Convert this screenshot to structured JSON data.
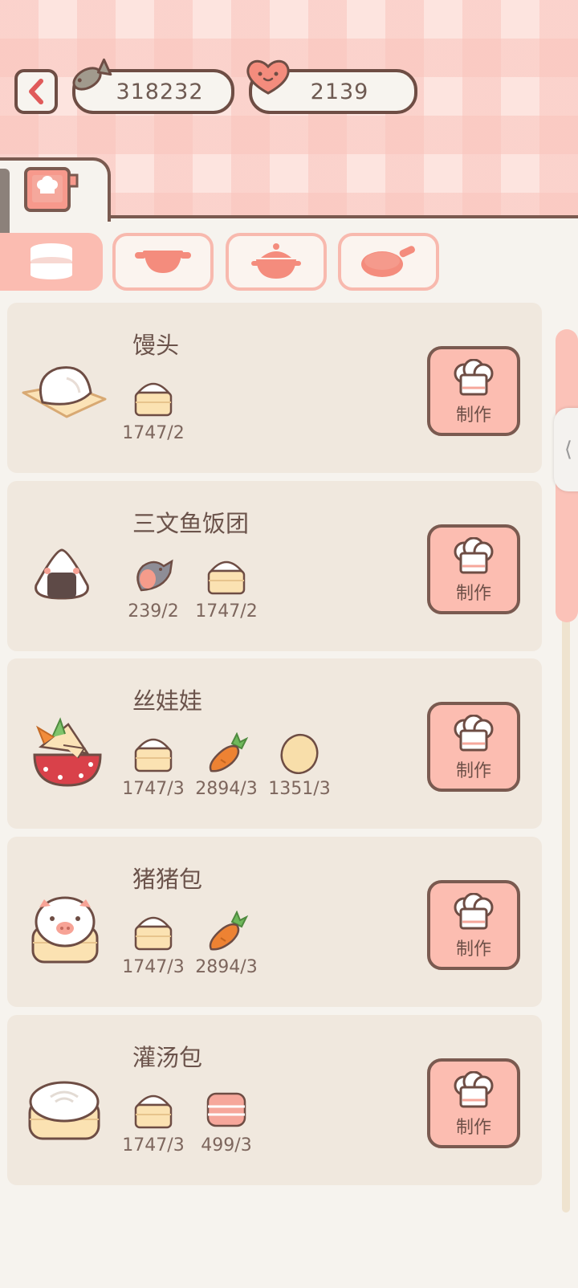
{
  "currency": {
    "fish": "318232",
    "heart": "2139"
  },
  "make_label": "制作",
  "recipes": [
    {
      "name": "馒头",
      "dish_icon": "steamed-bun-icon",
      "ingredients": [
        {
          "icon": "flour-steamer-icon",
          "count": "1747/2"
        }
      ]
    },
    {
      "name": "三文鱼饭团",
      "dish_icon": "onigiri-icon",
      "ingredients": [
        {
          "icon": "salmon-icon",
          "count": "239/2"
        },
        {
          "icon": "flour-steamer-icon",
          "count": "1747/2"
        }
      ]
    },
    {
      "name": "丝娃娃",
      "dish_icon": "spring-roll-icon",
      "ingredients": [
        {
          "icon": "flour-steamer-icon",
          "count": "1747/3"
        },
        {
          "icon": "carrot-icon",
          "count": "2894/3"
        },
        {
          "icon": "egg-icon",
          "count": "1351/3"
        }
      ]
    },
    {
      "name": "猪猪包",
      "dish_icon": "piggy-bun-icon",
      "ingredients": [
        {
          "icon": "flour-steamer-icon",
          "count": "1747/3"
        },
        {
          "icon": "carrot-icon",
          "count": "2894/3"
        }
      ]
    },
    {
      "name": "灌汤包",
      "dish_icon": "soup-dumpling-icon",
      "ingredients": [
        {
          "icon": "flour-steamer-icon",
          "count": "1747/3"
        },
        {
          "icon": "meat-icon",
          "count": "499/3"
        }
      ]
    }
  ],
  "colors": {
    "accent": "#fcbdb1",
    "outline": "#7a5a50",
    "card": "#f0e8de"
  }
}
